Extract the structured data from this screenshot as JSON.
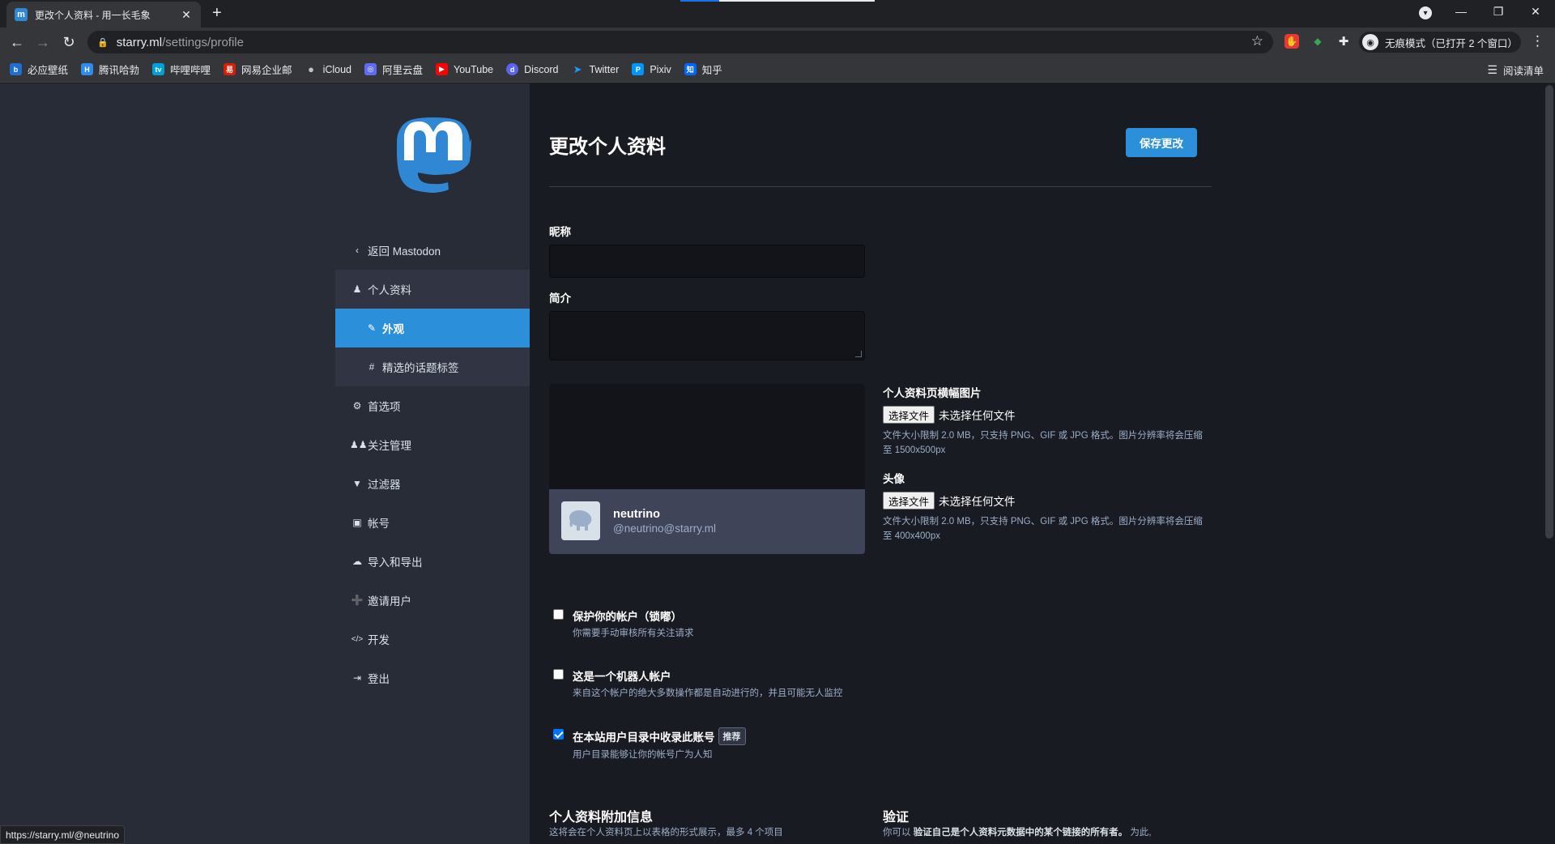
{
  "browser": {
    "tab_title": "更改个人资料 - 用一长毛象",
    "tab_favicon": "m",
    "new_tab": "+",
    "url_host": "starry.ml",
    "url_path": "/settings/profile",
    "incognito_label": "无痕模式（已打开 2 个窗口）",
    "reading_list": "阅读清单",
    "bookmarks": [
      {
        "label": "必应壁纸",
        "icon": "bing-icon",
        "color": "#1e6fd0"
      },
      {
        "label": "腾讯哈勃",
        "icon": "tencent-habo-icon",
        "color": "#2d8cf0"
      },
      {
        "label": "哔哩哔哩",
        "icon": "bilibili-icon",
        "color": "#00a1d6"
      },
      {
        "label": "网易企业邮",
        "icon": "netease-mail-icon",
        "color": "#d81e06"
      },
      {
        "label": "iCloud",
        "icon": "apple-icon",
        "color": "#5f6368"
      },
      {
        "label": "阿里云盘",
        "icon": "aliyun-drive-icon",
        "color": "#5e6bf2"
      },
      {
        "label": "YouTube",
        "icon": "youtube-icon",
        "color": "#ff0000"
      },
      {
        "label": "Discord",
        "icon": "discord-icon",
        "color": "#5865f2"
      },
      {
        "label": "Twitter",
        "icon": "twitter-icon",
        "color": "#1d9bf0"
      },
      {
        "label": "Pixiv",
        "icon": "pixiv-icon",
        "color": "#0096fa"
      },
      {
        "label": "知乎",
        "icon": "zhihu-icon",
        "color": "#0066ff"
      }
    ],
    "status_url": "https://starry.ml/@neutrino"
  },
  "sidebar": {
    "items": [
      {
        "label": "返回 Mastodon",
        "icon": "‹"
      },
      {
        "label": "个人资料",
        "icon": "👤"
      },
      {
        "label": "外观",
        "icon": "✎"
      },
      {
        "label": "精选的话题标签",
        "icon": "#"
      },
      {
        "label": "首选项",
        "icon": "⚙"
      },
      {
        "label": "关注管理",
        "icon": "👥"
      },
      {
        "label": "过滤器",
        "icon": "▼"
      },
      {
        "label": "帐号",
        "icon": "🔒"
      },
      {
        "label": "导入和导出",
        "icon": "☁"
      },
      {
        "label": "邀请用户",
        "icon": "➕"
      },
      {
        "label": "开发",
        "icon": "</>"
      },
      {
        "label": "登出",
        "icon": "⇥"
      }
    ]
  },
  "main": {
    "title": "更改个人资料",
    "save_label": "保存更改",
    "nickname_label": "昵称",
    "nickname_value": "",
    "bio_label": "简介",
    "bio_value": "",
    "preview": {
      "name": "neutrino",
      "handle": "@neutrino@starry.ml"
    },
    "header_upload": {
      "label": "个人资料页横幅图片",
      "button": "选择文件",
      "status": "未选择任何文件",
      "hint": "文件大小限制 2.0 MB，只支持 PNG、GIF 或 JPG 格式。图片分辨率将会压缩至 1500x500px"
    },
    "avatar_upload": {
      "label": "头像",
      "button": "选择文件",
      "status": "未选择任何文件",
      "hint": "文件大小限制 2.0 MB，只支持 PNG、GIF 或 JPG 格式。图片分辨率将会压缩至 400x400px"
    },
    "checks": [
      {
        "label": "保护你的帐户（锁嘟）",
        "hint": "你需要手动审核所有关注请求",
        "checked": false
      },
      {
        "label": "这是一个机器人帐户",
        "hint": "来自这个帐户的绝大多数操作都是自动进行的，并且可能无人监控",
        "checked": false
      },
      {
        "label": "在本站用户目录中收录此账号",
        "badge": "推荐",
        "hint": "用户目录能够让你的帐号广为人知",
        "checked": true
      }
    ],
    "fields_section": {
      "title": "个人资料附加信息",
      "hint": "这将会在个人资料页上以表格的形式展示，最多 4 个项目"
    },
    "verify_section": {
      "title": "验证",
      "hint_prefix": "你可以 ",
      "hint_bold": "验证自己是个人资料元数据中的某个链接的所有者。",
      "hint_suffix": " 为此,"
    }
  },
  "colors": {
    "accent": "#2b90d9",
    "sidebar_bg": "#282c37",
    "content_bg": "#191b22",
    "hint_text": "#9baec8"
  }
}
